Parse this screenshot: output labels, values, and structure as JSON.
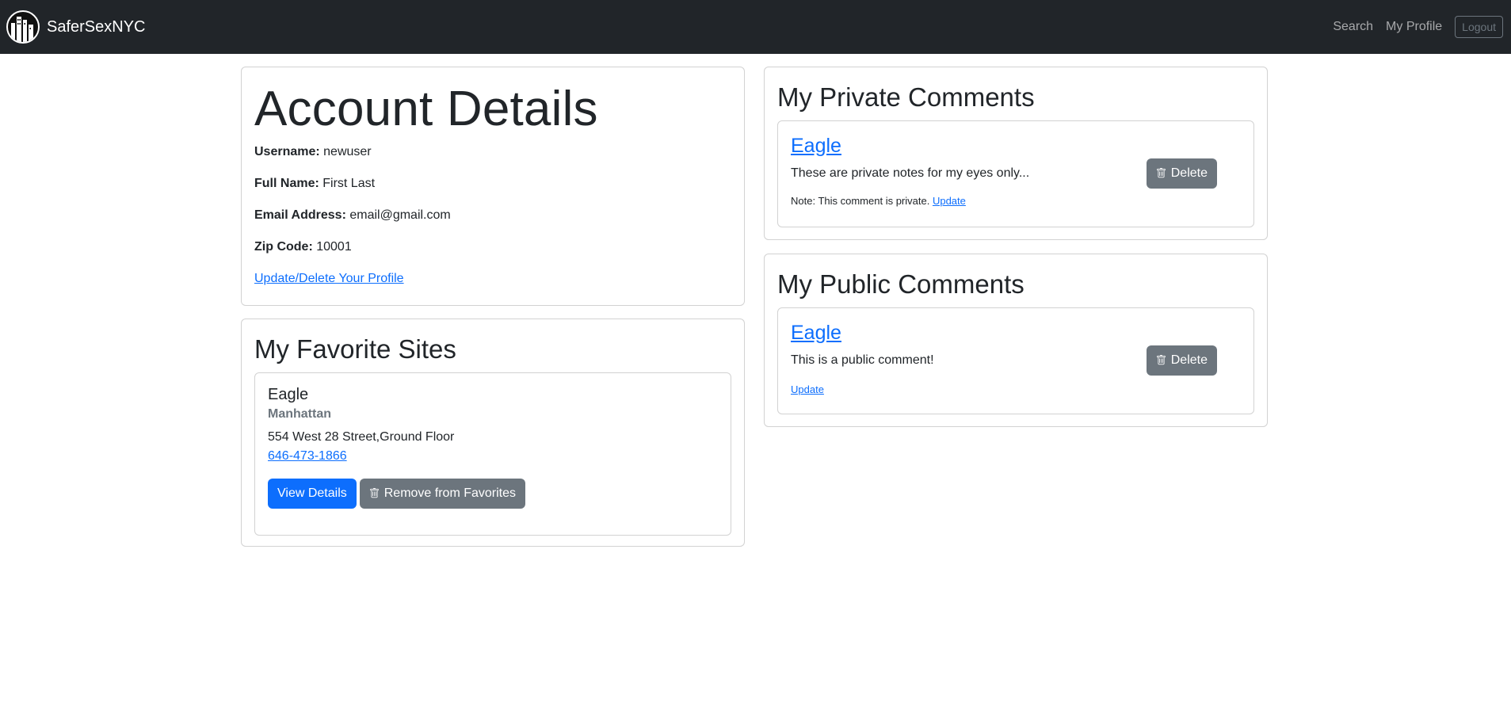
{
  "navbar": {
    "brand": "SaferSexNYC",
    "links": {
      "search": "Search",
      "profile": "My Profile"
    },
    "logout": "Logout"
  },
  "account": {
    "title": "Account Details",
    "username_label": "Username:",
    "username": "newuser",
    "fullname_label": "Full Name:",
    "fullname": "First Last",
    "email_label": "Email Address:",
    "email": "email@gmail.com",
    "zip_label": "Zip Code:",
    "zip": "10001",
    "update_link": "Update/Delete Your Profile"
  },
  "favorites": {
    "title": "My Favorite Sites",
    "site": {
      "name": "Eagle",
      "borough": "Manhattan",
      "address": "554 West 28 Street,Ground Floor",
      "phone": "646-473-1866",
      "view_label": "View Details",
      "remove_label": "Remove from Favorites"
    }
  },
  "private_comments": {
    "title": "My Private Comments",
    "comment": {
      "site": "Eagle",
      "text": "These are private notes for my eyes only...",
      "note": "Note: This comment is private.",
      "update": "Update",
      "delete": "Delete"
    }
  },
  "public_comments": {
    "title": "My Public Comments",
    "comment": {
      "site": "Eagle",
      "text": "This is a public comment!",
      "update": "Update",
      "delete": "Delete"
    }
  },
  "colors": {
    "navbar_bg": "#212529",
    "primary": "#0d6efd",
    "secondary": "#6c757d"
  },
  "icons": {
    "logo": "city-skyline-logo",
    "trash": "trash-icon"
  }
}
